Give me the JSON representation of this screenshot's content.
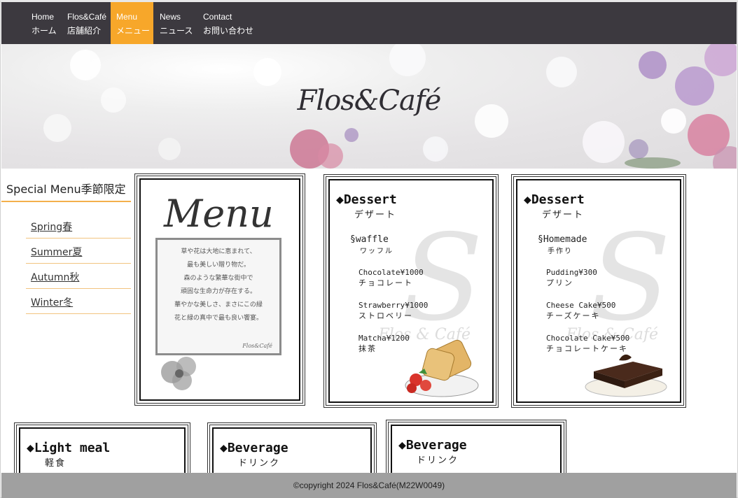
{
  "nav": {
    "items": [
      {
        "en": "Home",
        "jp": "ホーム"
      },
      {
        "en": "Flos&Café",
        "jp": "店舗紹介"
      },
      {
        "en": "Menu",
        "jp": "メニュー"
      },
      {
        "en": "News",
        "jp": "ニュース"
      },
      {
        "en": "Contact",
        "jp": "お問い合わせ"
      }
    ],
    "active_color": "#f7a72a",
    "bg_color": "#3c393f"
  },
  "hero": {
    "title": "Flos&Café"
  },
  "sidebar": {
    "title": "Special Menu季節限定",
    "items": [
      "Spring春",
      "Summer夏",
      "Autumn秋",
      "Winter冬"
    ]
  },
  "cover": {
    "title": "Menu",
    "lines": [
      "草や花は大地に恵まれて、",
      "最も美しい贈り物だ。",
      "森のような繁華な街中で",
      "頑固な生命力が存在する。",
      "華やかな美しさ、まさにこの緑",
      "花と緑の真中で最も良い饗宴。"
    ],
    "sign": "Flos&Café"
  },
  "cards": [
    {
      "title": "◆Dessert",
      "title_jp": "デザート",
      "sub": "§waffle",
      "sub_jp": "ワッフル",
      "rows": [
        {
          "en": "Chocolate¥1000",
          "jp": "チョコレート"
        },
        {
          "en": "Strawberry¥1000",
          "jp": "ストロベリー"
        },
        {
          "en": "Matcha¥1200",
          "jp": "抹茶"
        }
      ],
      "watermark": "Flos & Café"
    },
    {
      "title": "◆Dessert",
      "title_jp": "デザート",
      "sub": "§Homemade",
      "sub_jp": "手作り",
      "rows": [
        {
          "en": "Pudding¥300",
          "jp": "プリン"
        },
        {
          "en": "Cheese  Cake¥500",
          "jp": "チーズケーキ"
        },
        {
          "en": "Chocolate Cake¥500",
          "jp": "チョコレートケーキ"
        }
      ],
      "watermark": "Flos & Café"
    }
  ],
  "bottom_cards": [
    {
      "title": "◆Light meal",
      "title_jp": "軽食"
    },
    {
      "title": "◆Beverage",
      "title_jp": "ドリンク"
    },
    {
      "title": "◆Beverage",
      "title_jp": "ドリンク"
    }
  ],
  "footer": {
    "text": "©copyright 2024 Flos&Café(M22W0049)"
  }
}
